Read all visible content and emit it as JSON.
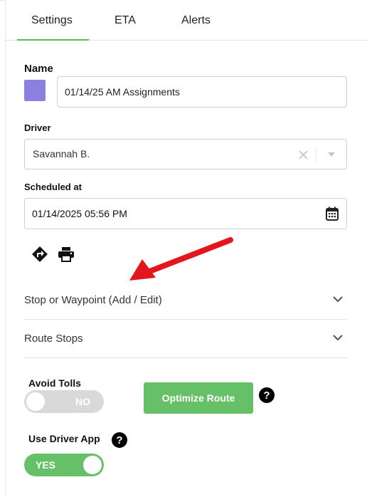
{
  "tabs": [
    {
      "label": "Settings",
      "active": true
    },
    {
      "label": "ETA",
      "active": false
    },
    {
      "label": "Alerts",
      "active": false
    }
  ],
  "form": {
    "name_label": "Name",
    "name_value": "01/14/25 AM Assignments",
    "swatch_color": "#8b7fe0",
    "driver_label": "Driver",
    "driver_value": "Savannah B.",
    "scheduled_label": "Scheduled at",
    "scheduled_value": "01/14/2025 05:56 PM"
  },
  "icons": {
    "directions": "directions-icon",
    "print": "print-icon",
    "calendar": "calendar-icon",
    "clear": "clear-x-icon",
    "dropdown": "chevron-down-icon"
  },
  "sections": [
    {
      "label": "Stop or Waypoint (Add / Edit)"
    },
    {
      "label": "Route Stops"
    }
  ],
  "options": {
    "avoid_tolls_label": "Avoid Tolls",
    "avoid_tolls_state": "NO",
    "optimize_button": "Optimize Route",
    "use_driver_app_label": "Use Driver App",
    "use_driver_app_state": "YES",
    "help_glyph": "?"
  },
  "colors": {
    "accent_green": "#66c068",
    "toggle_off": "#d9d9d9",
    "arrow_red": "#e3161b"
  }
}
